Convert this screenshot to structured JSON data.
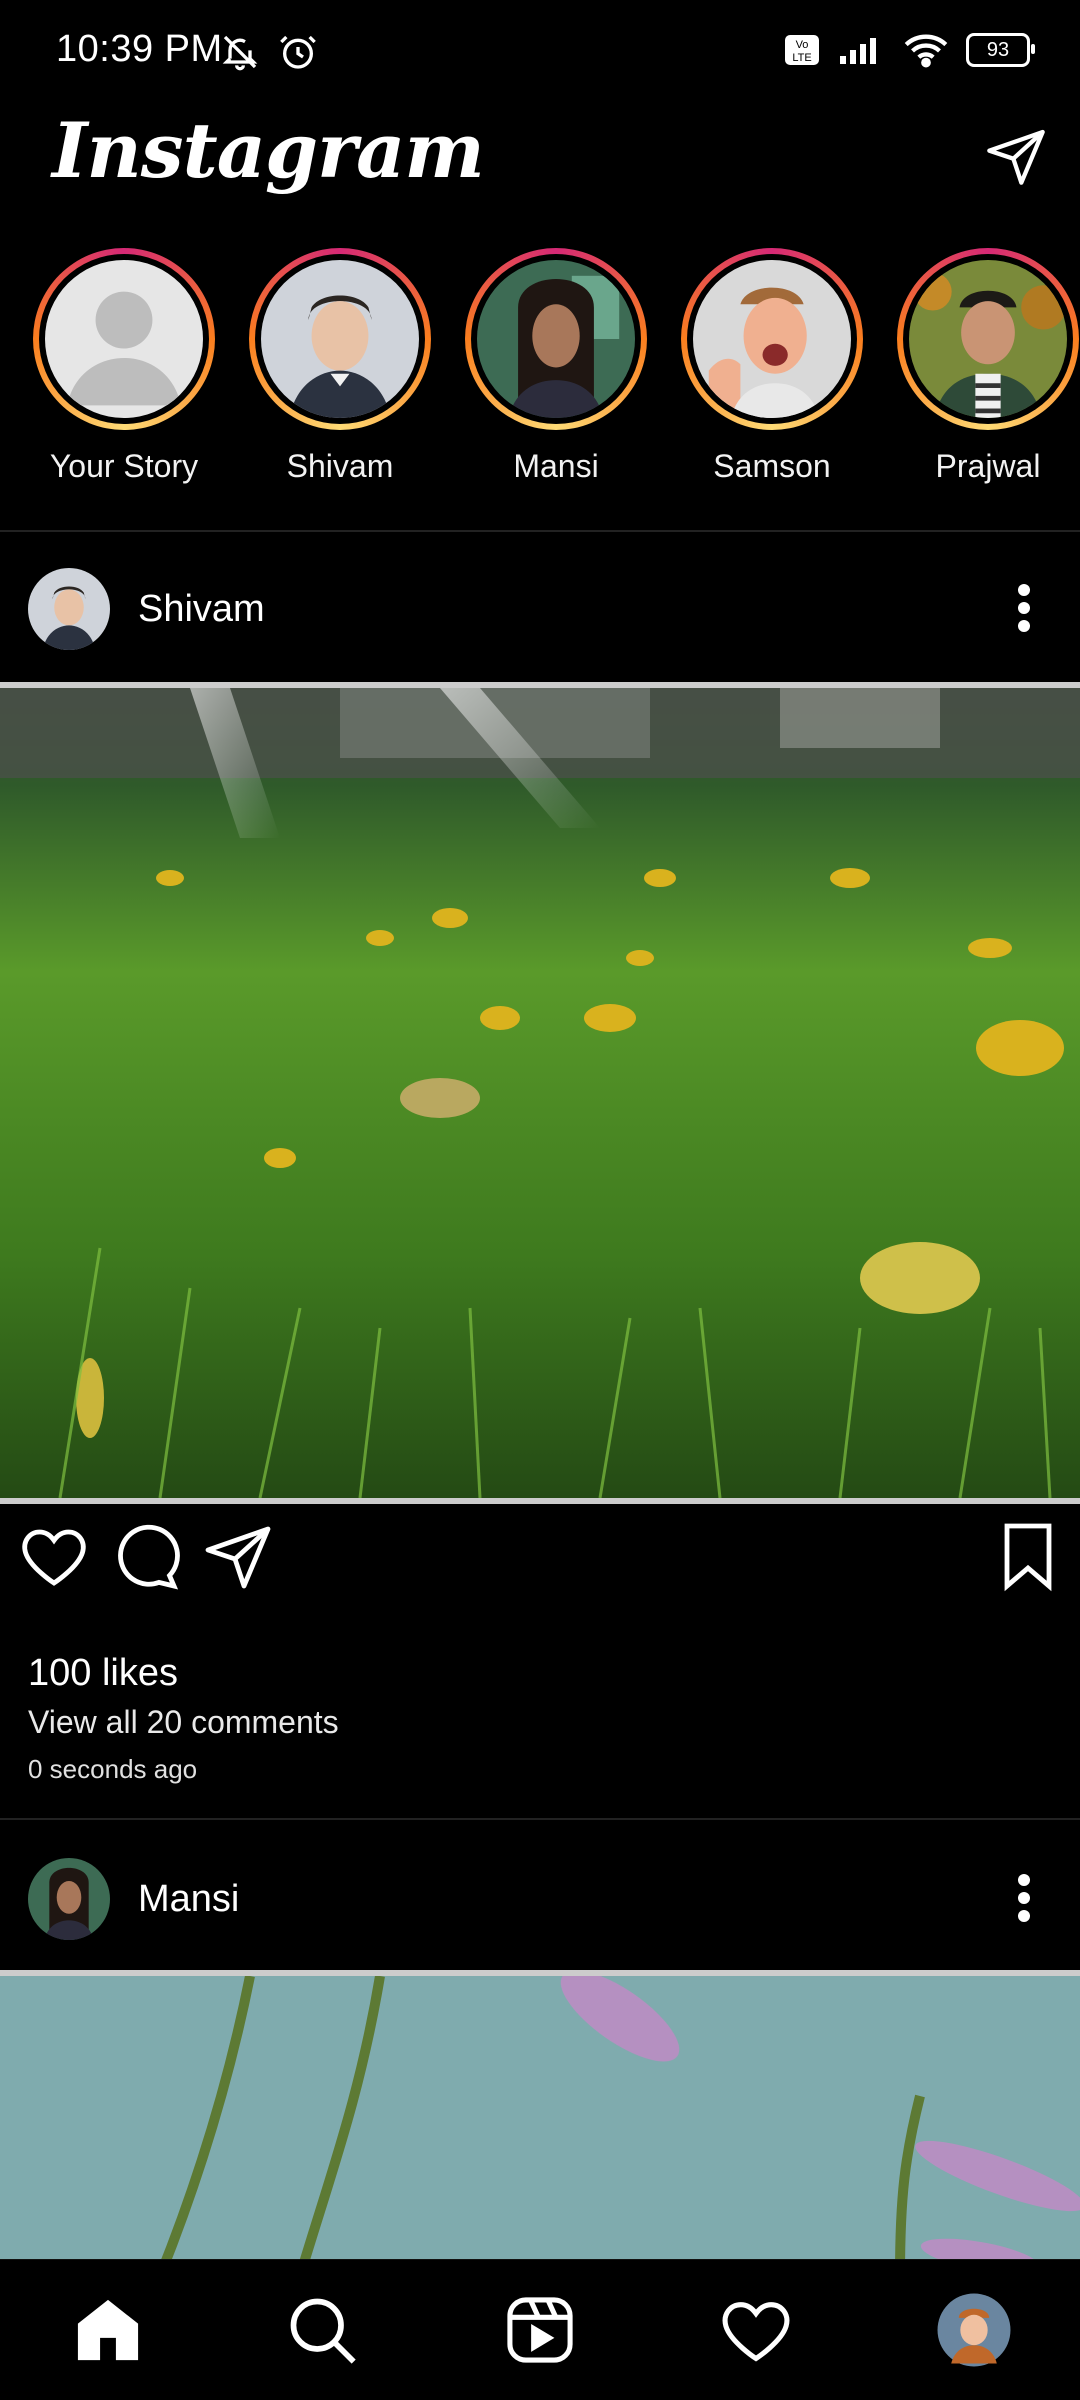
{
  "status": {
    "time": "10:39 PM",
    "battery": "93",
    "icons_left": [
      "bell-off-icon",
      "alarm-icon"
    ],
    "icons_right": [
      "volte-icon",
      "signal-icon",
      "wifi-icon",
      "battery-icon"
    ]
  },
  "header": {
    "brand": "Instagram",
    "direct_icon": "send-icon"
  },
  "stories": [
    {
      "name": "Your Story"
    },
    {
      "name": "Shivam"
    },
    {
      "name": "Mansi"
    },
    {
      "name": "Samson"
    },
    {
      "name": "Prajwal"
    }
  ],
  "posts": [
    {
      "user": "Shivam",
      "likes": "100 likes",
      "comments": "View all 20 comments",
      "time": "0 seconds ago"
    },
    {
      "user": "Mansi"
    }
  ],
  "nav": {
    "items": [
      "home-icon",
      "search-icon",
      "reels-icon",
      "heart-icon",
      "profile-avatar"
    ]
  },
  "colors": {
    "background": "#000000",
    "story_ring_start": "#d62976",
    "story_ring_end": "#fa7e1e"
  }
}
